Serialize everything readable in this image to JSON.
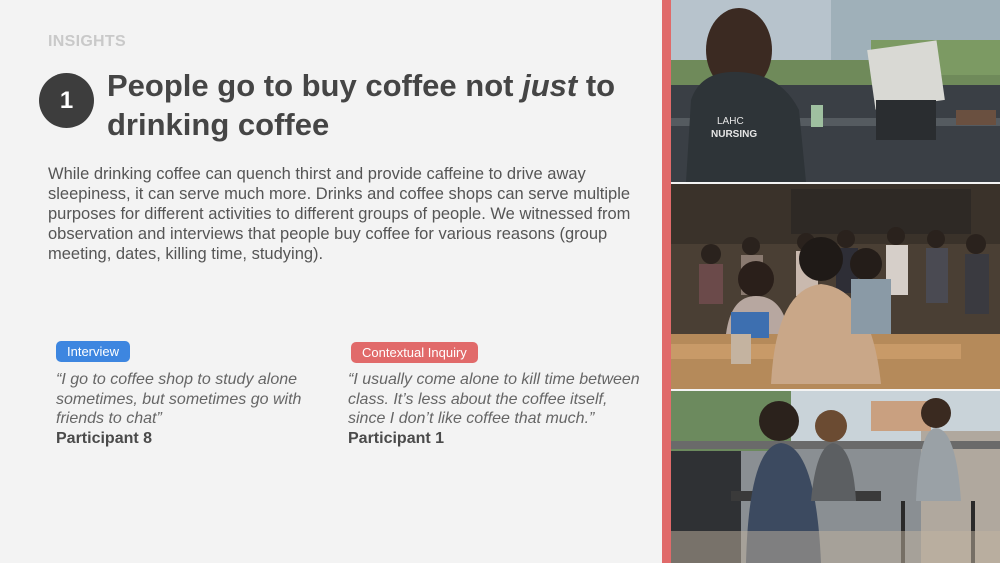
{
  "eyebrow": "INSIGHTS",
  "insight_number": "1",
  "headline": {
    "part1": "People go to buy coffee not ",
    "emphasis": "just",
    "part2": " to drinking coffee"
  },
  "body": "While drinking coffee can quench thirst and provide caffeine to drive away sleepiness, it can serve much more. Drinks and coffee shops can serve multiple purposes for different activities to different groups of people. We witnessed from observation and interviews that people buy coffee for various reasons (group meeting, dates, killing time, studying).",
  "quotes": [
    {
      "tag": "Interview",
      "text": "“I go to coffee shop to study alone sometimes, but sometimes go with friends to chat”",
      "participant": "Participant 8"
    },
    {
      "tag": "Contextual Inquiry",
      "text": "“I usually come alone to kill time between class. It’s less about the coffee itself, since I don’t like coffee that much.”",
      "participant": "Participant 1"
    }
  ],
  "photo_text": {
    "sweatshirt_line1": "LAHC",
    "sweatshirt_line2": "NURSING"
  },
  "colors": {
    "accent_red": "#e06a6a",
    "tag_blue": "#3d86e0",
    "tag_red": "#e16a6a",
    "number_circle": "#3d3d3d"
  }
}
